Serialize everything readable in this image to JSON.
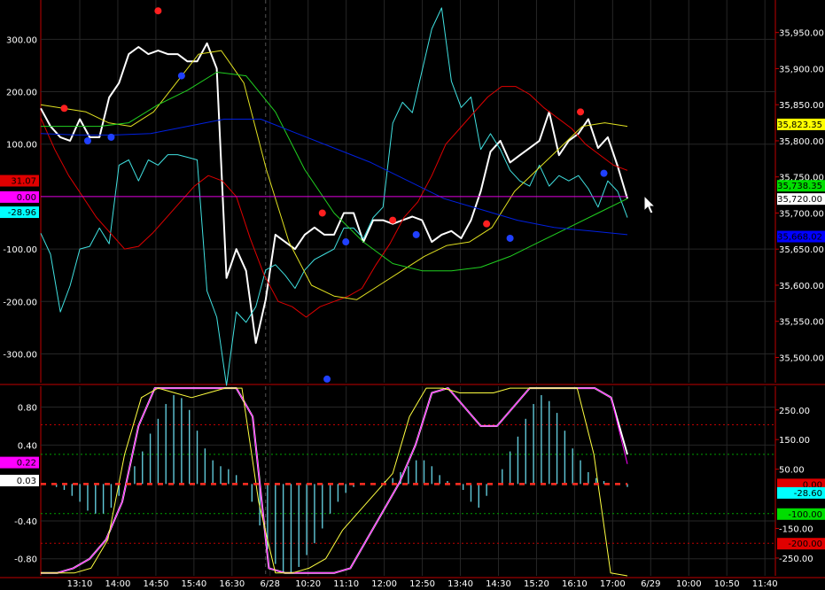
{
  "chart_data": [
    {
      "type": "line",
      "panel": "price",
      "x_labels": [
        "13:10",
        "14:00",
        "14:50",
        "15:40",
        "16:30",
        "6/28",
        "10:20",
        "11:10",
        "12:00",
        "12:50",
        "13:40",
        "14:30",
        "15:20",
        "16:10",
        "17:00",
        "6/29",
        "10:00",
        "10:50",
        "11:40"
      ],
      "left_axis": {
        "ticks": [
          "300.00",
          "200.00",
          "100.00",
          "-100.00",
          "-200.00",
          "-300.00"
        ],
        "values": [
          300,
          200,
          100,
          -100,
          -200,
          -300
        ],
        "range": [
          -355,
          375
        ]
      },
      "right_axis": {
        "ticks": [
          "35,950.00",
          "35,900.00",
          "35,850.00",
          "35,800.00",
          "35,750.00",
          "35,700.00",
          "35,650.00",
          "35,600.00",
          "35,550.00",
          "35,500.00"
        ],
        "values": [
          35950,
          35900,
          35850,
          35800,
          35750,
          35700,
          35650,
          35600,
          35550,
          35500
        ],
        "range": [
          35465,
          35995
        ]
      },
      "left_badges": [
        {
          "text": "31.07",
          "value": 31.07,
          "color": "#e00000",
          "text_color": "#000000"
        },
        {
          "text": "0.00",
          "value": 0,
          "color": "#ff00ff",
          "text_color": "#000000"
        },
        {
          "text": "-28.96",
          "value": -28.96,
          "color": "#00ffff",
          "text_color": "#000000"
        }
      ],
      "right_badges": [
        {
          "text": "35,823.35",
          "value": 35823.35,
          "color": "#ffff00",
          "text_color": "#000000"
        },
        {
          "text": "35,738.35",
          "value": 35738.35,
          "color": "#00dd00",
          "text_color": "#000000"
        },
        {
          "text": "35,720.00",
          "value": 35720,
          "color": "#ffffff",
          "text_color": "#000000"
        },
        {
          "text": "35,668.02",
          "value": 35668.02,
          "color": "#0000ff",
          "text_color": "#000000"
        }
      ],
      "series": [
        {
          "color": "#ffffff",
          "axis": "right",
          "values": [
            35845,
            35820,
            35805,
            35800,
            35830,
            35805,
            35805,
            35860,
            35880,
            35920,
            35930,
            35920,
            35925,
            35920,
            35920,
            35910,
            35910,
            35935,
            35900,
            35610,
            35650,
            35620,
            35520,
            35580,
            35670,
            35660,
            35650,
            35670,
            35680,
            35670,
            35670,
            35700,
            35700,
            35660,
            35690,
            35690,
            35685,
            35690,
            35695,
            35690,
            35660,
            35670,
            35675,
            35665,
            35690,
            35730,
            35785,
            35800,
            35770,
            35780,
            35790,
            35800,
            35840,
            35780,
            35800,
            35810,
            35830,
            35790,
            35805,
            35765,
            35720
          ]
        },
        {
          "color": "#40e0e0",
          "axis": "left",
          "values": [
            -70,
            -110,
            -220,
            -170,
            -100,
            -95,
            -60,
            -90,
            60,
            70,
            30,
            70,
            60,
            80,
            80,
            75,
            70,
            -180,
            -230,
            -360,
            -220,
            -240,
            -210,
            -140,
            -130,
            -150,
            -175,
            -140,
            -120,
            -110,
            -100,
            -60,
            -60,
            -80,
            -40,
            -20,
            140,
            180,
            160,
            240,
            320,
            360,
            220,
            170,
            190,
            90,
            120,
            90,
            50,
            30,
            20,
            60,
            20,
            40,
            30,
            40,
            15,
            -20,
            30,
            10,
            -40
          ]
        },
        {
          "color": "#e00000",
          "axis": "left",
          "values": [
            150,
            90,
            40,
            0,
            -40,
            -70,
            -100,
            -95,
            -70,
            -40,
            -10,
            20,
            40,
            30,
            0,
            -80,
            -150,
            -200,
            -210,
            -230,
            -210,
            -200,
            -190,
            -175,
            -130,
            -90,
            -40,
            -10,
            40,
            100,
            130,
            160,
            190,
            210,
            210,
            195,
            170,
            150,
            130,
            100,
            80,
            60,
            50
          ]
        },
        {
          "color": "#e0e020",
          "axis": "right",
          "values": [
            35850,
            35845,
            35840,
            35825,
            35820,
            35840,
            35880,
            35920,
            35925,
            35880,
            35760,
            35660,
            35600,
            35585,
            35580,
            35600,
            35620,
            35640,
            35655,
            35660,
            35680,
            35730,
            35760,
            35790,
            35820,
            35825,
            35820
          ]
        },
        {
          "color": "#20d020",
          "axis": "right",
          "values": [
            35820,
            35820,
            35820,
            35825,
            35850,
            35870,
            35895,
            35890,
            35840,
            35760,
            35700,
            35660,
            35630,
            35620,
            35620,
            35625,
            35640,
            35660,
            35680,
            35700,
            35720
          ]
        },
        {
          "color": "#0020e0",
          "axis": "right",
          "values": [
            35810,
            35808,
            35808,
            35810,
            35820,
            35830,
            35830,
            35810,
            35790,
            35770,
            35745,
            35720,
            35705,
            35690,
            35680,
            35675,
            35670
          ]
        },
        {
          "color": "#e000e0",
          "axis": "left",
          "values": [
            0,
            0
          ]
        }
      ],
      "markers": [
        {
          "color": "#ff2020",
          "points": [
            [
              1,
              35845
            ],
            [
              5,
              35980
            ],
            [
              12,
              35700
            ],
            [
              15,
              35690
            ],
            [
              19,
              35685
            ],
            [
              23,
              35840
            ]
          ],
          "axis": "right"
        },
        {
          "color": "#2040ff",
          "points": [
            [
              2,
              35800
            ],
            [
              3,
              35805
            ],
            [
              6,
              35890
            ],
            [
              13,
              35660
            ],
            [
              16,
              35670
            ],
            [
              20,
              35665
            ],
            [
              24,
              35755
            ],
            [
              12.2,
              35470
            ]
          ],
          "axis": "right"
        }
      ]
    },
    {
      "type": "bar",
      "panel": "oscillator",
      "left_axis": {
        "ticks": [
          "0.80",
          "0.40",
          "-0.40",
          "-0.80"
        ],
        "values": [
          0.8,
          0.4,
          -0.4,
          -0.8
        ],
        "range": [
          -0.98,
          1.02
        ]
      },
      "right_axis": {
        "ticks": [
          "250.00",
          "150.00",
          "50.00",
          "-150.00",
          "-250.00"
        ],
        "values": [
          250,
          150,
          50,
          -150,
          -250
        ],
        "range": [
          -310,
          330
        ]
      },
      "left_badges": [
        {
          "text": "0.22",
          "value": 0.22,
          "color": "#ff00ff",
          "text_color": "#000000"
        },
        {
          "text": "0.03",
          "value": 0.03,
          "color": "#ffffff",
          "text_color": "#000000"
        }
      ],
      "right_badges": [
        {
          "text": "0.00",
          "value": 0,
          "color": "#e00000",
          "text_color": "#000000"
        },
        {
          "text": "-28.60",
          "value": -28.6,
          "color": "#00ffff",
          "text_color": "#000000"
        },
        {
          "text": "-100.00",
          "value": -100,
          "color": "#00dd00",
          "text_color": "#000000"
        },
        {
          "text": "-200.00",
          "value": -200,
          "color": "#e00000",
          "text_color": "#000000"
        }
      ],
      "histogram_color": "#60c8d8",
      "histogram": [
        0,
        0,
        -10,
        -20,
        -40,
        -60,
        -90,
        -100,
        -100,
        -80,
        -40,
        0,
        60,
        110,
        170,
        220,
        270,
        300,
        290,
        250,
        180,
        120,
        80,
        60,
        50,
        30,
        0,
        -60,
        -140,
        -220,
        -270,
        -300,
        -300,
        -280,
        -240,
        -200,
        -150,
        -100,
        -60,
        -30,
        -10,
        0,
        0,
        0,
        10,
        20,
        40,
        60,
        80,
        80,
        60,
        30,
        10,
        0,
        -20,
        -60,
        -80,
        -40,
        0,
        50,
        110,
        160,
        220,
        270,
        300,
        280,
        240,
        180,
        120,
        80,
        40,
        20,
        10,
        0,
        0,
        -10
      ],
      "series": [
        {
          "color": "#ffffff",
          "axis": "left",
          "values": [
            -0.95,
            -0.95,
            -0.9,
            -0.8,
            -0.6,
            -0.2,
            0.6,
            1.0,
            1.0,
            1.0,
            1.0,
            1.0,
            1.0,
            0.7,
            -0.9,
            -0.95,
            -0.95,
            -0.95,
            -0.95,
            -0.9,
            -0.6,
            -0.3,
            0.0,
            0.4,
            0.95,
            1.0,
            0.8,
            0.6,
            0.6,
            0.8,
            1.0,
            1.0,
            1.0,
            1.0,
            1.0,
            0.9,
            0.3
          ]
        },
        {
          "color": "#ff00ff",
          "axis": "left",
          "values": [
            -0.95,
            -0.95,
            -0.9,
            -0.8,
            -0.6,
            -0.2,
            0.6,
            1.0,
            1.0,
            1.0,
            1.0,
            1.0,
            1.0,
            0.7,
            -0.9,
            -0.95,
            -0.95,
            -0.95,
            -0.95,
            -0.9,
            -0.6,
            -0.3,
            0.0,
            0.4,
            0.95,
            1.0,
            0.8,
            0.6,
            0.6,
            0.8,
            1.0,
            1.0,
            1.0,
            1.0,
            1.0,
            0.9,
            0.2
          ]
        },
        {
          "color": "#ffff40",
          "axis": "left",
          "values": [
            -0.95,
            -0.95,
            -0.95,
            -0.9,
            -0.6,
            0.3,
            0.9,
            1.0,
            0.95,
            0.9,
            0.95,
            1.0,
            1.0,
            -0.2,
            -0.95,
            -0.95,
            -0.9,
            -0.8,
            -0.5,
            -0.3,
            -0.1,
            0.1,
            0.7,
            1.0,
            1.0,
            0.95,
            0.95,
            0.95,
            1.0,
            1.0,
            1.0,
            1.0,
            1.0,
            0.3,
            -0.95,
            -0.98
          ]
        },
        {
          "color": "#20e020",
          "axis": "right",
          "values": [
            0,
            0
          ],
          "dashed": true
        },
        {
          "color": "#ff2020",
          "axis": "right",
          "values": [
            0,
            0
          ],
          "dashed": true
        }
      ],
      "reference_lines": [
        {
          "value": 200,
          "color": "#c00000"
        },
        {
          "value": 100,
          "color": "#00a000"
        },
        {
          "value": -100,
          "color": "#00a000"
        },
        {
          "value": -200,
          "color": "#c00000"
        }
      ]
    }
  ]
}
